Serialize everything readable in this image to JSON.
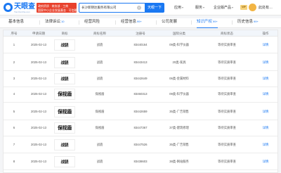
{
  "header": {
    "logo_text": "天眼查",
    "logo_sub": "TianYanCha.com",
    "promo_lines": [
      "政府资质 · 商务部 · 工商",
      "国家中小企业发展基金 · 可信赖"
    ],
    "search_value": "长沙新钥达服务有限公司",
    "search_button": "天眼一下",
    "nav": [
      {
        "label": "应用",
        "chev": true
      },
      {
        "label": "服务",
        "chev": true
      },
      {
        "label": "企业版产品",
        "chev": true
      }
    ],
    "vip_label": "VIP",
    "user_label": "此处有…"
  },
  "tabs": [
    {
      "label": "基本信息",
      "count": ""
    },
    {
      "label": "法律诉讼",
      "count": "10"
    },
    {
      "label": "经营风险",
      "count": ""
    },
    {
      "label": "经营信息",
      "count": "99+"
    },
    {
      "label": "公司发展",
      "count": ""
    },
    {
      "label": "知识产权",
      "count": "99+"
    },
    {
      "label": "历史信息",
      "count": "99+"
    }
  ],
  "active_tab": "知识产权",
  "table": {
    "columns": [
      "序号",
      "申请日期",
      "商标",
      "商标名称",
      "注册号",
      "国际分类",
      "商标状态",
      "操作"
    ],
    "rows": [
      {
        "no": "1",
        "date": "2025-02-13",
        "mark": "战骁",
        "name": "战骁",
        "reg": "83440164",
        "cls": "09类-科学仪器",
        "status": "等待实质审查",
        "action": "详情"
      },
      {
        "no": "2",
        "date": "2025-02-13",
        "mark": "战骁",
        "name": "战骁",
        "reg": "83443413",
        "cls": "20类-家具",
        "status": "等待实质审查",
        "action": "详情"
      },
      {
        "no": "3",
        "date": "2025-02-13",
        "mark": "战骁",
        "name": "战骁",
        "reg": "83442649",
        "cls": "06类-金属材料",
        "status": "等待实质审查",
        "action": "详情"
      },
      {
        "no": "4",
        "date": "2025-02-13",
        "mark": "保视盾",
        "name": "保视盾",
        "reg": "83460313",
        "cls": "09类-科学仪器",
        "status": "等待实质审查",
        "action": "详情"
      },
      {
        "no": "5",
        "date": "2025-02-13",
        "mark": "保视盾",
        "name": "保视盾",
        "reg": "83442659",
        "cls": "35类-广告销售",
        "status": "等待实质审查",
        "action": "详情"
      },
      {
        "no": "6",
        "date": "2025-02-13",
        "mark": "保视盾",
        "name": "保视盾",
        "reg": "83447367",
        "cls": "37类-建筑修理",
        "status": "等待实质审查",
        "action": "详情"
      },
      {
        "no": "7",
        "date": "2025-02-13",
        "mark": "战骁",
        "name": "战骁",
        "reg": "83447526",
        "cls": "35类-广告销售",
        "status": "等待实质审查",
        "action": "详情"
      },
      {
        "no": "8",
        "date": "2025-02-13",
        "mark": "战骁",
        "name": "战骁",
        "reg": "83438603",
        "cls": "38类-网站服务",
        "status": "等待实质审查",
        "action": "详情"
      }
    ]
  }
}
